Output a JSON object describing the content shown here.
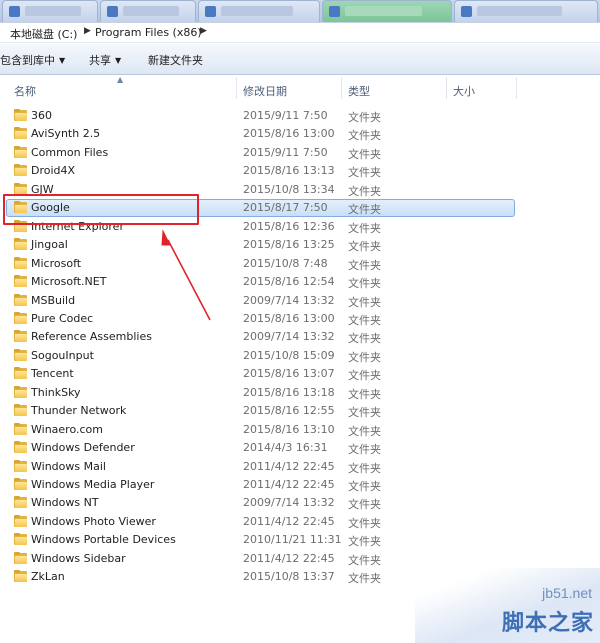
{
  "address_bar": {
    "crumbs": [
      "本地磁盘 (C:)",
      "Program Files (x86)"
    ]
  },
  "toolbar": {
    "include_in_library": "包含到库中",
    "share": "共享",
    "new_folder": "新建文件夹"
  },
  "columns": {
    "name": "名称",
    "modified": "修改日期",
    "type": "类型",
    "size": "大小"
  },
  "files": [
    {
      "name": "360",
      "modified": "2015/9/11 7:50",
      "type": "文件夹"
    },
    {
      "name": "AviSynth 2.5",
      "modified": "2015/8/16 13:00",
      "type": "文件夹"
    },
    {
      "name": "Common Files",
      "modified": "2015/9/11 7:50",
      "type": "文件夹"
    },
    {
      "name": "Droid4X",
      "modified": "2015/8/16 13:13",
      "type": "文件夹"
    },
    {
      "name": "GJW",
      "modified": "2015/10/8 13:34",
      "type": "文件夹"
    },
    {
      "name": "Google",
      "modified": "2015/8/17 7:50",
      "type": "文件夹",
      "selected": true
    },
    {
      "name": "Internet Explorer",
      "modified": "2015/8/16 12:36",
      "type": "文件夹"
    },
    {
      "name": "Jingoal",
      "modified": "2015/8/16 13:25",
      "type": "文件夹"
    },
    {
      "name": "Microsoft",
      "modified": "2015/10/8 7:48",
      "type": "文件夹"
    },
    {
      "name": "Microsoft.NET",
      "modified": "2015/8/16 12:54",
      "type": "文件夹"
    },
    {
      "name": "MSBuild",
      "modified": "2009/7/14 13:32",
      "type": "文件夹"
    },
    {
      "name": "Pure Codec",
      "modified": "2015/8/16 13:00",
      "type": "文件夹"
    },
    {
      "name": "Reference Assemblies",
      "modified": "2009/7/14 13:32",
      "type": "文件夹"
    },
    {
      "name": "SogouInput",
      "modified": "2015/10/8 15:09",
      "type": "文件夹"
    },
    {
      "name": "Tencent",
      "modified": "2015/8/16 13:07",
      "type": "文件夹"
    },
    {
      "name": "ThinkSky",
      "modified": "2015/8/16 13:18",
      "type": "文件夹"
    },
    {
      "name": "Thunder Network",
      "modified": "2015/8/16 12:55",
      "type": "文件夹"
    },
    {
      "name": "Winaero.com",
      "modified": "2015/8/16 13:10",
      "type": "文件夹"
    },
    {
      "name": "Windows Defender",
      "modified": "2014/4/3 16:31",
      "type": "文件夹"
    },
    {
      "name": "Windows Mail",
      "modified": "2011/4/12 22:45",
      "type": "文件夹"
    },
    {
      "name": "Windows Media Player",
      "modified": "2011/4/12 22:45",
      "type": "文件夹"
    },
    {
      "name": "Windows NT",
      "modified": "2009/7/14 13:32",
      "type": "文件夹"
    },
    {
      "name": "Windows Photo Viewer",
      "modified": "2011/4/12 22:45",
      "type": "文件夹"
    },
    {
      "name": "Windows Portable Devices",
      "modified": "2010/11/21 11:31",
      "type": "文件夹"
    },
    {
      "name": "Windows Sidebar",
      "modified": "2011/4/12 22:45",
      "type": "文件夹"
    },
    {
      "name": "ZkLan",
      "modified": "2015/10/8 13:37",
      "type": "文件夹"
    }
  ],
  "watermark": {
    "site": "jb51.net",
    "brand": "脚本之家"
  },
  "colors": {
    "annotation": "#e0242c",
    "selection_border": "#84acdd",
    "folder": "#f3c550"
  }
}
